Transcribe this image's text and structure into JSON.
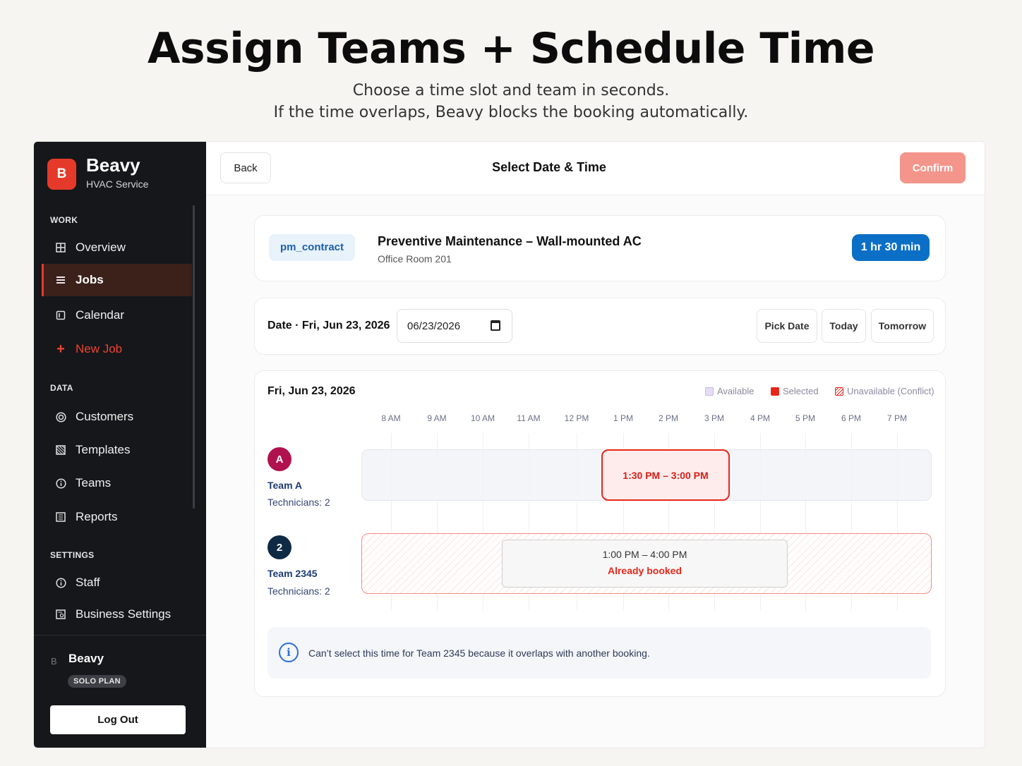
{
  "hero": {
    "title": "Assign Teams + Schedule Time",
    "subtitle_1": "Choose a time slot and team in seconds.",
    "subtitle_2": "If the time overlaps, Beavy blocks the booking automatically."
  },
  "sidebar": {
    "logo_letter": "B",
    "brand": "Beavy",
    "brand_sub": "HVAC Service",
    "sections": {
      "work": "WORK",
      "data": "DATA",
      "settings": "SETTINGS"
    },
    "items": {
      "overview": "Overview",
      "jobs": "Jobs",
      "calendar": "Calendar",
      "new_job": "New Job",
      "customers": "Customers",
      "templates": "Templates",
      "teams": "Teams",
      "reports": "Reports",
      "staff": "Staff",
      "business_settings": "Business Settings"
    },
    "user": {
      "initial": "B",
      "name": "Beavy",
      "plan": "SOLO PLAN"
    },
    "logout": "Log Out"
  },
  "topbar": {
    "back": "Back",
    "title": "Select Date & Time",
    "confirm": "Confirm"
  },
  "job": {
    "tag": "pm_contract",
    "title": "Preventive Maintenance – Wall-mounted AC",
    "location": "Office Room 201",
    "duration": "1 hr 30 min"
  },
  "date_picker": {
    "label": "Date · Fri, Jun 23, 2026",
    "value": "06/23/2026",
    "pick_date": "Pick Date",
    "today": "Today",
    "tomorrow": "Tomorrow"
  },
  "schedule": {
    "date": "Fri, Jun 23, 2026",
    "legend": {
      "available": "Available",
      "selected": "Selected",
      "conflict": "Unavailable (Conflict)"
    },
    "hours": [
      "8 AM",
      "9 AM",
      "10 AM",
      "11 AM",
      "12 PM",
      "1 PM",
      "2 PM",
      "3 PM",
      "4 PM",
      "5 PM",
      "6 PM",
      "7 PM"
    ],
    "teams": [
      {
        "avatar": "A",
        "name": "Team A",
        "technicians": "Technicians: 2"
      },
      {
        "avatar": "2",
        "name": "Team 2345",
        "technicians": "Technicians: 2"
      }
    ],
    "selected_slot": "1:30 PM – 3:00 PM",
    "booked_slot": {
      "time": "1:00 PM – 4:00 PM",
      "status": "Already booked"
    },
    "notice": "Can’t select this time for Team 2345 because it overlaps with another booking."
  },
  "colors": {
    "accent_red": "#e53a2a",
    "confirm_disabled": "#f3958b",
    "duration_blue": "#0b6fc6",
    "team_a": "#b0124f",
    "team_b": "#0f2a44"
  }
}
